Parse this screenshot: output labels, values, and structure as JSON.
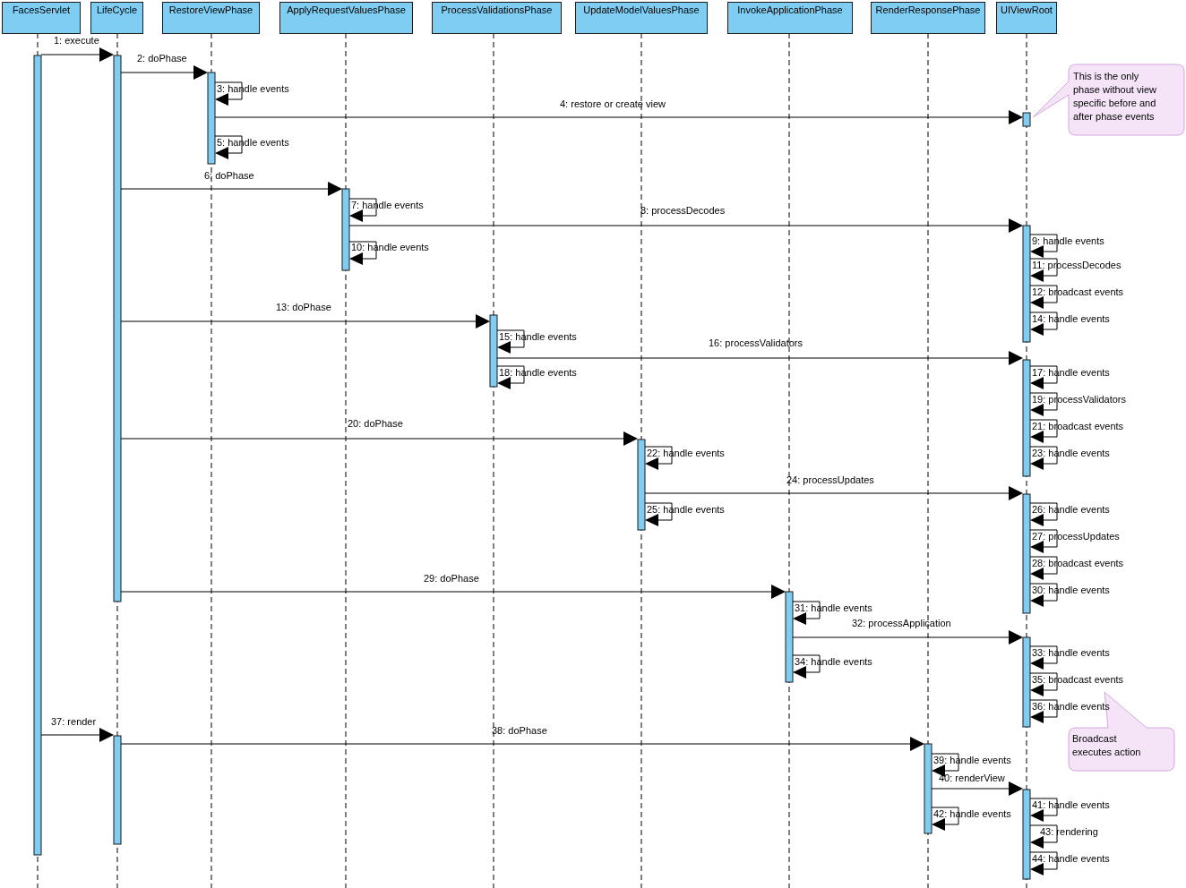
{
  "lifelines": [
    "FacesServlet",
    "LifeCycle",
    "RestoreViewPhase",
    "ApplyRequestValuesPhase",
    "ProcessValidationsPhase",
    "UpdateModelValuesPhase",
    "InvokeApplicationPhase",
    "RenderResponsePhase",
    "UIViewRoot"
  ],
  "messages": [
    {
      "kind": "call",
      "label": "1: execute"
    },
    {
      "kind": "call",
      "label": "2: doPhase"
    },
    {
      "kind": "self",
      "label": "3: handle events"
    },
    {
      "kind": "call",
      "label": "4: restore or create view"
    },
    {
      "kind": "self",
      "label": "5: handle events"
    },
    {
      "kind": "call",
      "label": "6: doPhase"
    },
    {
      "kind": "self",
      "label": "7: handle events"
    },
    {
      "kind": "call",
      "label": "8: processDecodes"
    },
    {
      "kind": "self",
      "label": "9: handle events"
    },
    {
      "kind": "self",
      "label": "10: handle events"
    },
    {
      "kind": "self",
      "label": "11: processDecodes"
    },
    {
      "kind": "self",
      "label": "12: broadcast events"
    },
    {
      "kind": "call",
      "label": "13: doPhase"
    },
    {
      "kind": "self",
      "label": "14: handle events"
    },
    {
      "kind": "self",
      "label": "15: handle events"
    },
    {
      "kind": "call",
      "label": "16: processValidators"
    },
    {
      "kind": "self",
      "label": "17: handle events"
    },
    {
      "kind": "self",
      "label": "18: handle events"
    },
    {
      "kind": "self",
      "label": "19: processValidators"
    },
    {
      "kind": "call",
      "label": "20: doPhase"
    },
    {
      "kind": "self",
      "label": "21: broadcast events"
    },
    {
      "kind": "self",
      "label": "22: handle events"
    },
    {
      "kind": "self",
      "label": "23: handle events"
    },
    {
      "kind": "call",
      "label": "24: processUpdates"
    },
    {
      "kind": "self",
      "label": "25: handle events"
    },
    {
      "kind": "self",
      "label": "26: handle events"
    },
    {
      "kind": "self",
      "label": "27: processUpdates"
    },
    {
      "kind": "self",
      "label": "28: broadcast events"
    },
    {
      "kind": "call",
      "label": "29: doPhase"
    },
    {
      "kind": "self",
      "label": "30: handle events"
    },
    {
      "kind": "self",
      "label": "31: handle events"
    },
    {
      "kind": "call",
      "label": "32: processApplication"
    },
    {
      "kind": "self",
      "label": "33: handle events"
    },
    {
      "kind": "self",
      "label": "34: handle events"
    },
    {
      "kind": "self",
      "label": "35: broadcast events"
    },
    {
      "kind": "self",
      "label": "36: handle events"
    },
    {
      "kind": "call",
      "label": "37: render"
    },
    {
      "kind": "call",
      "label": "38: doPhase"
    },
    {
      "kind": "self",
      "label": "39: handle events"
    },
    {
      "kind": "call",
      "label": "40: renderView"
    },
    {
      "kind": "self",
      "label": "41: handle events"
    },
    {
      "kind": "self",
      "label": "42: handle events"
    },
    {
      "kind": "self",
      "label": "43: rendering"
    },
    {
      "kind": "self",
      "label": "44: handle events"
    }
  ],
  "notes": [
    {
      "lines": [
        "This is the only",
        "phase without view",
        "specific before and",
        "after phase events"
      ]
    },
    {
      "lines": [
        "Broadcast",
        "executes action"
      ]
    }
  ]
}
